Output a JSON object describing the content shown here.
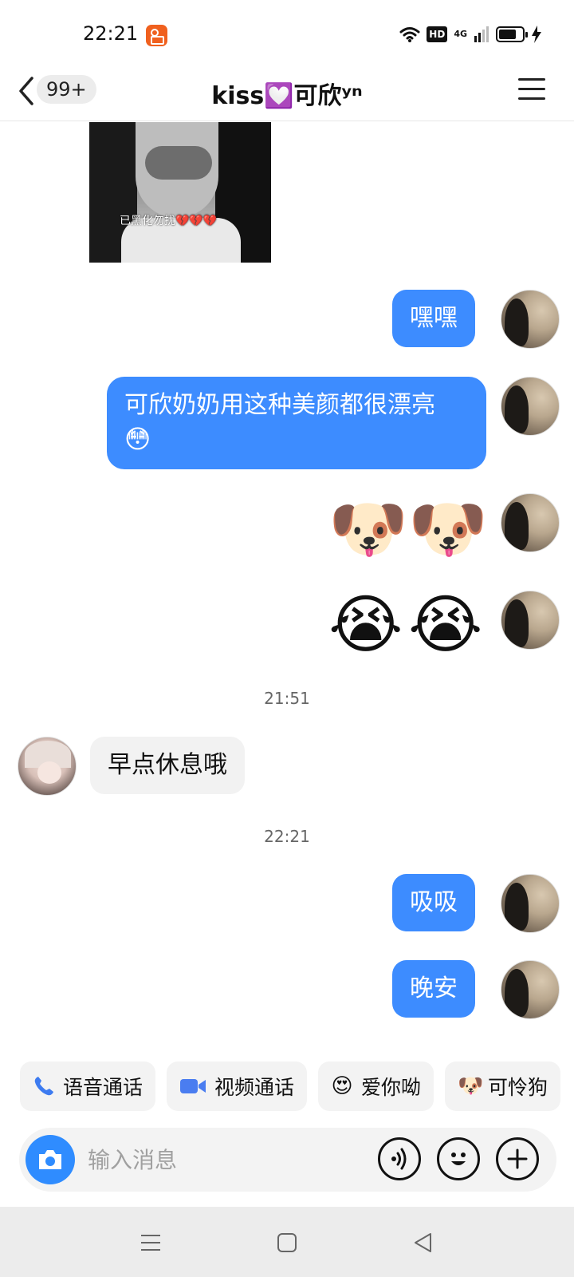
{
  "status_bar": {
    "time": "22:21",
    "hd": "HD",
    "network": "4G",
    "battery_level": 0.75
  },
  "header": {
    "unread": "99+",
    "title": "kiss💟可欣ʸⁿ"
  },
  "photo": {
    "caption": "已黑化勿扰",
    "caption_hearts": "💔💔💔"
  },
  "messages": {
    "m1": "嘿嘿",
    "m2": "可欣奶奶用这种美颜都很漂亮",
    "m2_emoji": "😳",
    "doge": [
      "🐶",
      "🐶"
    ],
    "cry": [
      "😭",
      "😭"
    ],
    "time1": "21:51",
    "m3": "早点休息哦",
    "time2": "22:21",
    "m4": "吸吸",
    "m5": "晚安"
  },
  "quick_actions": {
    "voice_call": "语音通话",
    "video_call": "视频通话",
    "love_you": "爱你呦",
    "love_you_emoji": "😍",
    "pitiful_dog": "可怜狗",
    "pitiful_dog_emoji": "🐶"
  },
  "input": {
    "placeholder": "输入消息"
  },
  "colors": {
    "bubble_out": "#3d8cff",
    "camera": "#2f8cff",
    "notification_app": "#f0601e"
  },
  "icons": {
    "back": "chevron-left-icon",
    "menu": "hamburger-menu-icon",
    "camera": "camera-icon",
    "voice": "voice-input-icon",
    "emoji": "emoji-icon",
    "plus": "plus-icon",
    "phone": "phone-icon",
    "video": "video-camera-icon"
  }
}
